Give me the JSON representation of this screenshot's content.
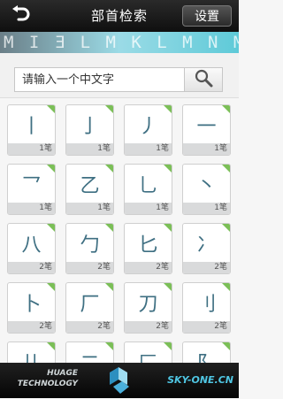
{
  "header": {
    "title": "部首检索",
    "settings_label": "设置"
  },
  "banner": {
    "text": "M I Ǝ L M K L M N M"
  },
  "search": {
    "placeholder": "请输入一个中文字"
  },
  "tiles": [
    {
      "char": "丨",
      "strokes": "1笔"
    },
    {
      "char": "亅",
      "strokes": "1笔"
    },
    {
      "char": "丿",
      "strokes": "1笔"
    },
    {
      "char": "一",
      "strokes": "1笔"
    },
    {
      "char": "乛",
      "strokes": "1笔"
    },
    {
      "char": "乙",
      "strokes": "1笔"
    },
    {
      "char": "乚",
      "strokes": "1笔"
    },
    {
      "char": "丶",
      "strokes": "1笔"
    },
    {
      "char": "八",
      "strokes": "2笔"
    },
    {
      "char": "勹",
      "strokes": "2笔"
    },
    {
      "char": "匕",
      "strokes": "2笔"
    },
    {
      "char": "冫",
      "strokes": "2笔"
    },
    {
      "char": "卜",
      "strokes": "2笔"
    },
    {
      "char": "厂",
      "strokes": "2笔"
    },
    {
      "char": "刀",
      "strokes": "2笔"
    },
    {
      "char": "刂",
      "strokes": "2笔"
    },
    {
      "char": "儿",
      "strokes": ""
    },
    {
      "char": "二",
      "strokes": ""
    },
    {
      "char": "匚",
      "strokes": ""
    },
    {
      "char": "阝",
      "strokes": ""
    }
  ],
  "footer": {
    "brand_line1": "HUAGE",
    "brand_line2": "TECHNOLOGY",
    "site": "SKY-ONE.CN"
  },
  "colors": {
    "accent_green": "#7bbf57",
    "char_color": "#3e6f82",
    "site_color": "#4fc6e3"
  }
}
